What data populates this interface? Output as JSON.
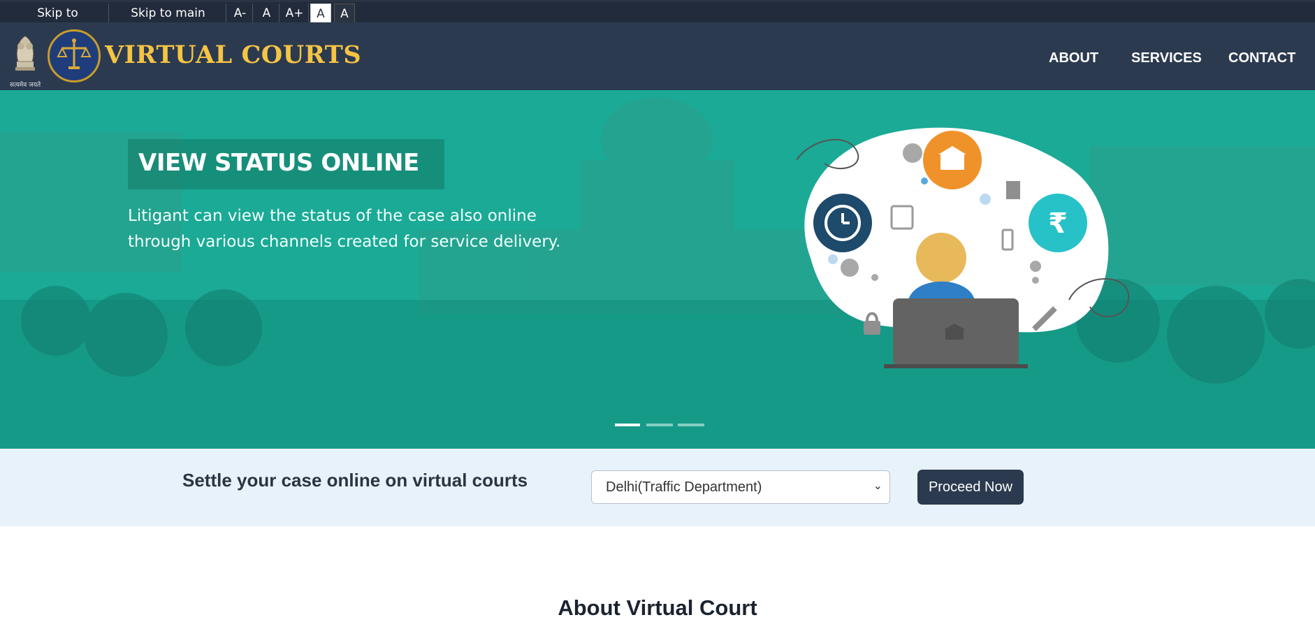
{
  "accessibility": {
    "skip_nav": "Skip to navigation",
    "skip_main": "Skip to main content",
    "font_decrease": "A-",
    "font_normal": "A",
    "font_increase": "A+",
    "theme_light": "A",
    "theme_dark": "A"
  },
  "header": {
    "brand": "VIRTUAL COURTS",
    "emblem_caption": "सत्यमेव जयते",
    "nav": [
      "ABOUT",
      "SERVICES",
      "CONTACT"
    ]
  },
  "hero": {
    "title": "VIEW STATUS ONLINE",
    "description": "Litigant can view the status of the case also online through various channels created for service delivery.",
    "slide_count": 3,
    "active_slide": 1,
    "rupee_symbol": "₹"
  },
  "settle": {
    "label": "Settle your case online on virtual courts",
    "selected_department": "Delhi(Traffic Department)",
    "proceed_label": "Proceed Now"
  },
  "about": {
    "title": "About Virtual Court"
  },
  "colors": {
    "header_bg": "#2c3a4f",
    "brand_gold": "#f5c444",
    "hero_teal": "#1aaa96",
    "settle_bg": "#e8f2fb",
    "button_dark": "#2b3a4e"
  }
}
